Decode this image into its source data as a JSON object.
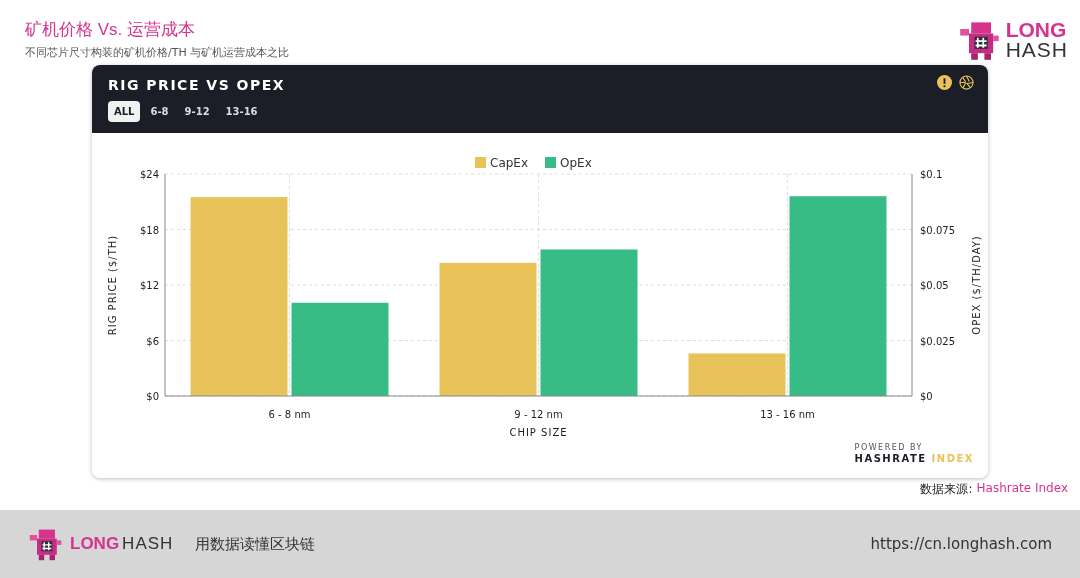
{
  "header": {
    "title": "矿机价格 Vs. 运营成本",
    "subtitle": "不同芯片尺寸构装的矿机价格/TH 与矿机运营成本之比"
  },
  "brand": {
    "word_1": "LONG",
    "word_2": "HASH"
  },
  "card": {
    "title": "RIG PRICE VS OPEX",
    "tabs": [
      {
        "label": "ALL",
        "selected": true
      },
      {
        "label": "6-8",
        "selected": false
      },
      {
        "label": "9-12",
        "selected": false
      },
      {
        "label": "13-16",
        "selected": false
      }
    ],
    "chart_data": {
      "type": "bar",
      "grid": true,
      "legend": "top",
      "xlabel": "CHIP SIZE",
      "ylabel": "RIG PRICE ($/TH)",
      "y2label": "OPEX ($/TH/DAY)",
      "categories": [
        "6 - 8 nm",
        "9 - 12 nm",
        "13 - 16 nm"
      ],
      "series": [
        {
          "name": "CapEx",
          "color": "#e8c35a",
          "values": [
            21.5,
            14.4,
            4.6
          ]
        },
        {
          "name": "OpEx",
          "color": "#37bc86",
          "axis": "y2",
          "values": [
            0.042,
            0.066,
            0.09
          ]
        }
      ],
      "ylim": [
        0,
        24
      ],
      "yticks": [
        {
          "value": 0,
          "label": "$0"
        },
        {
          "value": 6,
          "label": "$6"
        },
        {
          "value": 12,
          "label": "$12"
        },
        {
          "value": 18,
          "label": "$18"
        },
        {
          "value": 24,
          "label": "$24"
        }
      ],
      "y2lim": [
        0,
        0.1
      ],
      "y2ticks": [
        {
          "value": 0,
          "label": "$0"
        },
        {
          "value": 0.025,
          "label": "$0.025"
        },
        {
          "value": 0.05,
          "label": "$0.05"
        },
        {
          "value": 0.075,
          "label": "$0.075"
        },
        {
          "value": 0.1,
          "label": "$0.1"
        }
      ]
    },
    "powered_by": "POWERED BY",
    "credit_1": "HASHRATE",
    "credit_2": "INDEX"
  },
  "source": {
    "label": "数据来源:",
    "link": "Hashrate Index"
  },
  "footer": {
    "word_1": "LONG",
    "word_2": "HASH",
    "slogan": "用数据读懂区块链",
    "url": "https://cn.longhash.com"
  }
}
